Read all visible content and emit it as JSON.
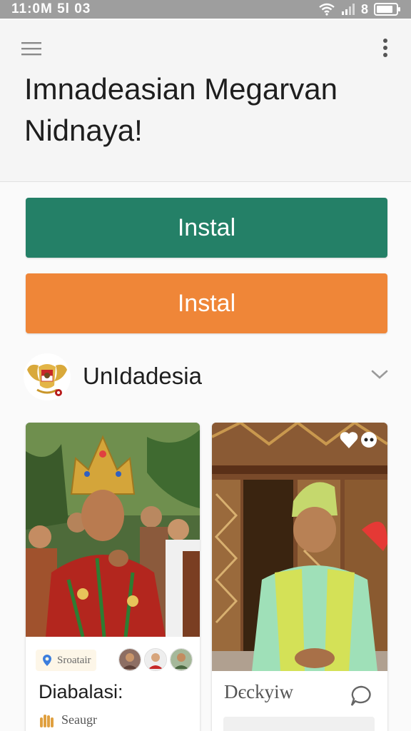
{
  "status_bar": {
    "time": "11:0M 5l 03",
    "battery_number": "8"
  },
  "header": {
    "title": "Imnadeasian Megarvan Nidnaya!"
  },
  "buttons": {
    "primary_label": "Instal",
    "secondary_label": "Instal"
  },
  "section": {
    "title": "UnIdadesia"
  },
  "cards": [
    {
      "tag_label": "Sroatair",
      "title": "Diabalasi:",
      "subtitle": "Seaugr"
    },
    {
      "title": "Dєckyiw"
    }
  ],
  "colors": {
    "status_bar": "#9e9e9e",
    "primary_button": "#248067",
    "secondary_button": "#ef8638"
  }
}
